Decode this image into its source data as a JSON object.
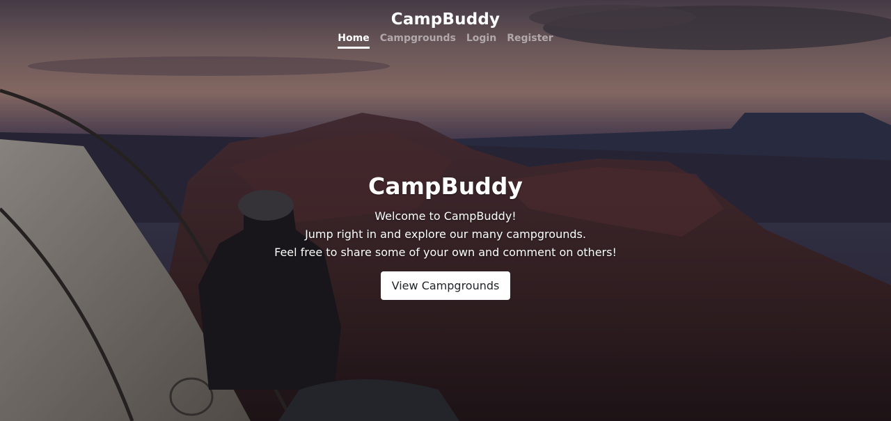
{
  "header": {
    "brand": "CampBuddy",
    "nav": [
      {
        "label": "Home",
        "active": true
      },
      {
        "label": "Campgrounds",
        "active": false
      },
      {
        "label": "Login",
        "active": false
      },
      {
        "label": "Register",
        "active": false
      }
    ]
  },
  "hero": {
    "title": "CampBuddy",
    "lines": [
      "Welcome to CampBuddy!",
      "Jump right in and explore our many campgrounds.",
      "Feel free to share some of your own and comment on others!"
    ],
    "button_label": "View Campgrounds"
  }
}
